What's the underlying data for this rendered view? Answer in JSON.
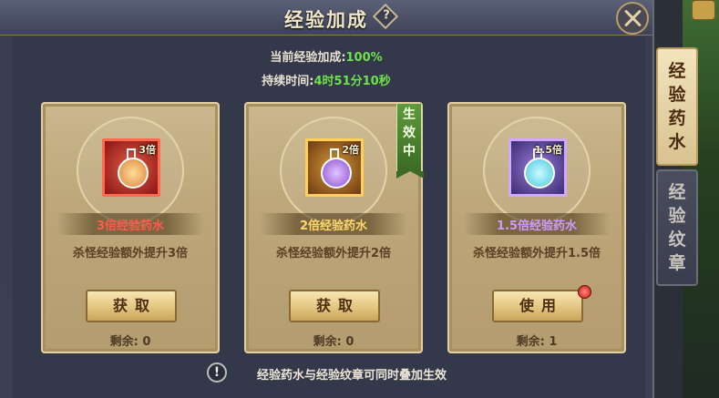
{
  "window": {
    "title": "经验加成",
    "help_glyph": "?"
  },
  "info": {
    "bonus_label": "当前经验加成:",
    "bonus_value": "100%",
    "duration_label": "持续时间:",
    "duration_value": "4时51分10秒"
  },
  "cards": [
    {
      "multiplier": "3倍",
      "name": "3倍经验药水",
      "description": "杀怪经验额外提升3倍",
      "button": "获取",
      "remaining": "剩余: 0",
      "name_color": "#ff5b4a",
      "icon": "red-potion-icon"
    },
    {
      "multiplier": "2倍",
      "name": "2倍经验药水",
      "description": "杀怪经验额外提升2倍",
      "button": "获取",
      "remaining": "剩余: 0",
      "active_tag": "生效中",
      "name_color": "#ffd86a",
      "icon": "purple-potion-icon"
    },
    {
      "multiplier": "1.5倍",
      "name": "1.5倍经验药水",
      "description": "杀怪经验额外提升1.5倍",
      "button": "使用",
      "remaining": "剩余: 1",
      "name_color": "#cf9bff",
      "icon": "blue-potion-icon",
      "has_notification": true
    }
  ],
  "footer": {
    "icon_glyph": "!",
    "text": "经验药水与经验纹章可同时叠加生效"
  },
  "tabs": [
    {
      "label": "经验药水",
      "chars": [
        "经",
        "验",
        "药",
        "水"
      ],
      "active": true
    },
    {
      "label": "经验纹章",
      "chars": [
        "经",
        "验",
        "纹",
        "章"
      ],
      "active": false
    }
  ]
}
